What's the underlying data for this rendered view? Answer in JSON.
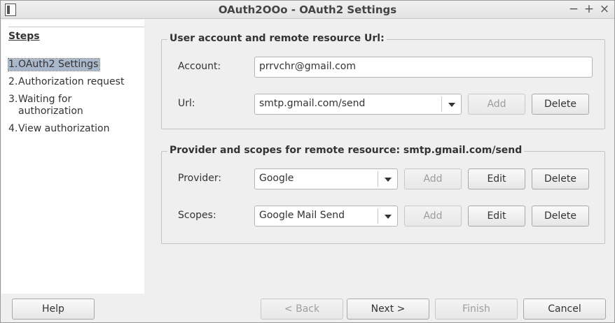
{
  "window": {
    "title": "OAuth2OOo - OAuth2 Settings",
    "controls": {
      "minimize": "−",
      "maximize": "+",
      "close": "×"
    }
  },
  "steps": {
    "title": "Steps",
    "items": [
      {
        "num": "1.",
        "label": "OAuth2 Settings"
      },
      {
        "num": "2.",
        "label": "Authorization request"
      },
      {
        "num": "3.",
        "label_line1": "Waiting for",
        "label_line2": "authorization"
      },
      {
        "num": "4.",
        "label": "View authorization"
      }
    ]
  },
  "account_group": {
    "title": "User account and remote resource Url:",
    "account_label": "Account:",
    "account_value": "prrvchr@gmail.com",
    "url_label": "Url:",
    "url_value": "smtp.gmail.com/send",
    "add_label": "Add",
    "delete_label": "Delete"
  },
  "provider_group": {
    "title": "Provider and scopes for remote resource: smtp.gmail.com/send",
    "provider_label": "Provider:",
    "provider_value": "Google",
    "scopes_label": "Scopes:",
    "scopes_value": "Google Mail Send",
    "add_label": "Add",
    "edit_label": "Edit",
    "delete_label": "Delete"
  },
  "footer": {
    "help": "Help",
    "back": "< Back",
    "next": "Next >",
    "finish": "Finish",
    "cancel": "Cancel"
  }
}
